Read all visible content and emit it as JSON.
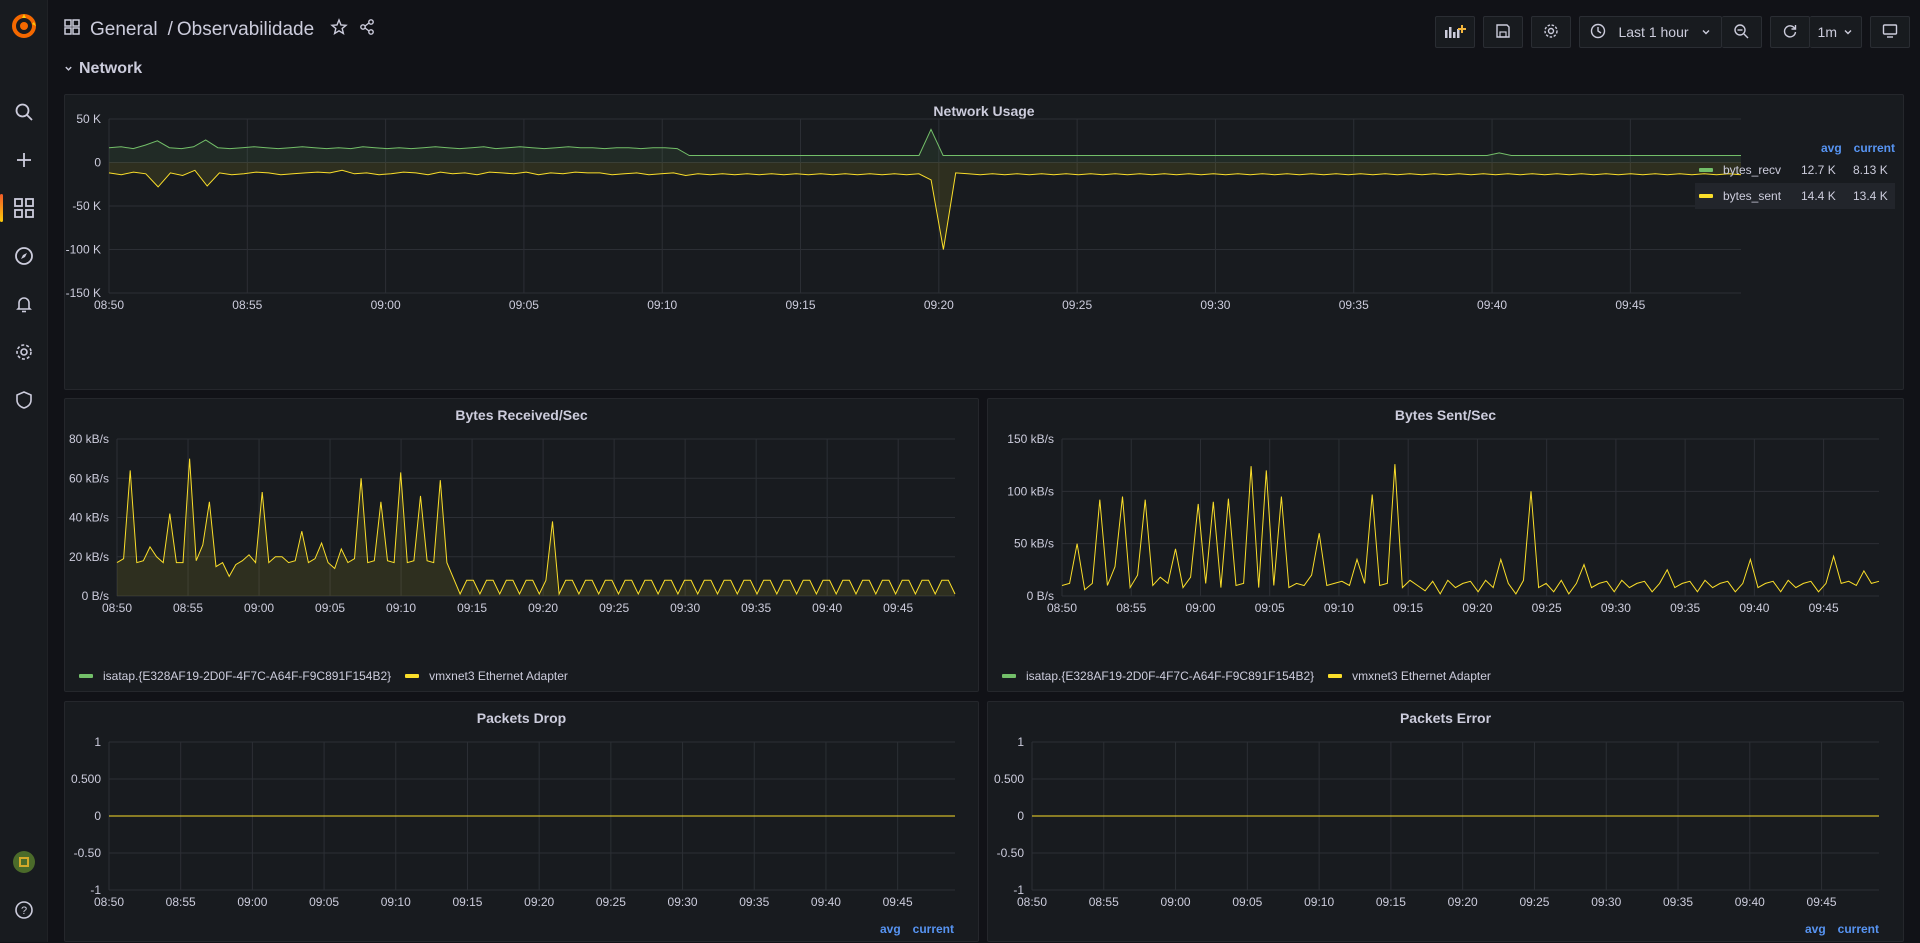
{
  "breadcrumb": {
    "folder": "General",
    "separator": "/",
    "dashboard": "Observabilidade"
  },
  "toolbar": {
    "time_range": "Last 1 hour",
    "refresh_interval": "1m"
  },
  "row": {
    "title": "Network"
  },
  "colors": {
    "recv": "#73bf69",
    "sent": "#fade2a",
    "accent": "#5794f2",
    "bg": "#111217",
    "panel": "#181b1f"
  },
  "icons": [
    "grafana-logo-icon",
    "search-icon",
    "plus-icon",
    "dashboards-icon",
    "explore-icon",
    "alert-bell-icon",
    "gear-icon",
    "shield-icon",
    "user-avatar-icon",
    "help-icon",
    "apps-grid-icon",
    "star-icon",
    "share-icon",
    "add-panel-icon",
    "save-icon",
    "settings-icon",
    "clock-icon",
    "chevron-down-icon",
    "zoom-out-icon",
    "refresh-icon",
    "tv-mode-icon"
  ],
  "network_usage": {
    "title": "Network Usage",
    "legend": {
      "col_avg": "avg",
      "col_current": "current",
      "rows": [
        {
          "name": "bytes_recv",
          "avg": "12.7 K",
          "current": "8.13 K"
        },
        {
          "name": "bytes_sent",
          "avg": "14.4 K",
          "current": "13.4 K"
        }
      ]
    }
  },
  "bytes_received": {
    "title": "Bytes Received/Sec",
    "legend": [
      "isatap.{E328AF19-2D0F-4F7C-A64F-F9C891F154B2}",
      "vmxnet3 Ethernet Adapter"
    ]
  },
  "bytes_sent": {
    "title": "Bytes Sent/Sec",
    "legend": [
      "isatap.{E328AF19-2D0F-4F7C-A64F-F9C891F154B2}",
      "vmxnet3 Ethernet Adapter"
    ]
  },
  "packets_drop": {
    "title": "Packets Drop",
    "col_avg": "avg",
    "col_current": "current"
  },
  "packets_error": {
    "title": "Packets Error",
    "col_avg": "avg",
    "col_current": "current"
  },
  "chart_data": [
    {
      "type": "line",
      "title": "Network Usage",
      "x_ticks": [
        "08:50",
        "08:55",
        "09:00",
        "09:05",
        "09:10",
        "09:15",
        "09:20",
        "09:25",
        "09:30",
        "09:35",
        "09:40",
        "09:45"
      ],
      "y_ticks": [
        "50 K",
        "0",
        "-50 K",
        "-100 K",
        "-150 K"
      ],
      "ylim": [
        -150000,
        50000
      ],
      "series": [
        {
          "name": "bytes_recv",
          "color": "#73bf69",
          "values": [
            17000,
            18000,
            16000,
            20000,
            25000,
            17000,
            16000,
            18000,
            26000,
            17000,
            16000,
            17000,
            18000,
            17000,
            16000,
            17000,
            18000,
            17000,
            16000,
            17000,
            16000,
            18000,
            17000,
            16000,
            17000,
            16000,
            17000,
            18000,
            17000,
            16000,
            17000,
            18000,
            16000,
            17000,
            18000,
            17000,
            16000,
            17000,
            18000,
            17000,
            17000,
            16000,
            17000,
            17000,
            16000,
            17000,
            17000,
            16000,
            8000,
            8000,
            8000,
            8000,
            8000,
            8000,
            8000,
            8000,
            8000,
            8000,
            8000,
            8000,
            8000,
            8000,
            8000,
            8000,
            8000,
            8000,
            8000,
            8000,
            38000,
            8000,
            8000,
            8000,
            8000,
            8000,
            8000,
            8000,
            8000,
            8000,
            8000,
            8000,
            8000,
            8000,
            8000,
            8000,
            8000,
            8000,
            8000,
            8000,
            8000,
            8000,
            8000,
            8000,
            8000,
            8000,
            8000,
            8000,
            8000,
            8000,
            8000,
            8000,
            8000,
            8000,
            8000,
            8000,
            8000,
            8000,
            8000,
            8000,
            8000,
            8000,
            8000,
            8000,
            8000,
            8000,
            8000,
            11000,
            8000,
            8000,
            8000,
            8000,
            8000,
            8000,
            8000,
            8000,
            8000,
            8000,
            8000,
            8000,
            8000,
            8000,
            8000,
            8000,
            8000,
            8000,
            8000,
            8000
          ]
        },
        {
          "name": "bytes_sent",
          "color": "#fade2a",
          "values": [
            -12000,
            -14000,
            -11000,
            -13000,
            -28000,
            -12000,
            -15000,
            -9000,
            -27000,
            -12000,
            -14000,
            -13000,
            -11000,
            -12000,
            -14000,
            -13000,
            -12000,
            -11000,
            -12000,
            -9000,
            -13000,
            -12000,
            -14000,
            -13000,
            -11000,
            -12000,
            -14000,
            -11000,
            -13000,
            -12000,
            -14000,
            -11000,
            -12000,
            -13000,
            -11000,
            -14000,
            -12000,
            -13000,
            -11000,
            -12000,
            -12000,
            -14000,
            -13000,
            -12000,
            -14000,
            -13000,
            -12000,
            -15000,
            -13000,
            -14000,
            -13000,
            -14000,
            -13000,
            -14000,
            -13000,
            -14000,
            -13000,
            -14000,
            -13000,
            -14000,
            -13000,
            -14000,
            -13000,
            -14000,
            -13000,
            -14000,
            -13000,
            -20000,
            -100000,
            -12000,
            -13000,
            -14000,
            -13000,
            -14000,
            -13000,
            -14000,
            -13000,
            -14000,
            -13000,
            -14000,
            -13000,
            -14000,
            -13000,
            -14000,
            -13000,
            -14000,
            -13000,
            -14000,
            -13000,
            -14000,
            -13000,
            -14000,
            -13000,
            -14000,
            -13000,
            -14000,
            -13000,
            -14000,
            -13000,
            -14000,
            -13000,
            -14000,
            -13000,
            -14000,
            -13000,
            -14000,
            -13000,
            -14000,
            -13000,
            -14000,
            -13000,
            -14000,
            -13000,
            -14000,
            -13000,
            -14000,
            -13000,
            -14000,
            -13000,
            -14000,
            -13000,
            -14000,
            -13000,
            -14000,
            -13000,
            -14000,
            -13000,
            -14000,
            -13000,
            -14000,
            -13000,
            -14000,
            -13000,
            -14000
          ]
        }
      ]
    },
    {
      "type": "area",
      "title": "Bytes Received/Sec",
      "x_ticks": [
        "08:50",
        "08:55",
        "09:00",
        "09:05",
        "09:10",
        "09:15",
        "09:20",
        "09:25",
        "09:30",
        "09:35",
        "09:40",
        "09:45"
      ],
      "y_ticks": [
        "80 kB/s",
        "60 kB/s",
        "40 kB/s",
        "20 kB/s",
        "0 B/s"
      ],
      "ylim": [
        0,
        80
      ],
      "series": [
        {
          "name": "isatap.{E328AF19-2D0F-4F7C-A64F-F9C891F154B2}",
          "color": "#73bf69",
          "values": []
        },
        {
          "name": "vmxnet3 Ethernet Adapter",
          "color": "#fade2a",
          "values": [
            17,
            19,
            64,
            17,
            18,
            25,
            20,
            17,
            42,
            17,
            17,
            70,
            18,
            26,
            48,
            15,
            17,
            10,
            16,
            18,
            21,
            17,
            53,
            17,
            20,
            20,
            17,
            18,
            33,
            17,
            19,
            27,
            17,
            14,
            24,
            17,
            19,
            60,
            17,
            18,
            48,
            18,
            17,
            63,
            17,
            18,
            51,
            18,
            17,
            59,
            17,
            9,
            1,
            8,
            8,
            1,
            8,
            8,
            1,
            8,
            8,
            1,
            8,
            8,
            1,
            8,
            38,
            1,
            8,
            8,
            1,
            8,
            8,
            1,
            8,
            8,
            1,
            8,
            8,
            1,
            8,
            8,
            1,
            8,
            8,
            1,
            8,
            8,
            1,
            8,
            8,
            1,
            8,
            8,
            1,
            8,
            8,
            1,
            8,
            8,
            1,
            8,
            8,
            1,
            8,
            8,
            1,
            8,
            8,
            1,
            8,
            8,
            1,
            8,
            8,
            1,
            8,
            8,
            1,
            8,
            8,
            1,
            8,
            8,
            1,
            8,
            8,
            1
          ]
        }
      ]
    },
    {
      "type": "line",
      "title": "Bytes Sent/Sec",
      "x_ticks": [
        "08:50",
        "08:55",
        "09:00",
        "09:05",
        "09:10",
        "09:15",
        "09:20",
        "09:25",
        "09:30",
        "09:35",
        "09:40",
        "09:45"
      ],
      "y_ticks": [
        "150 kB/s",
        "100 kB/s",
        "50 kB/s",
        "0 B/s"
      ],
      "ylim": [
        0,
        150
      ],
      "series": [
        {
          "name": "isatap.{E328AF19-2D0F-4F7C-A64F-F9C891F154B2}",
          "color": "#73bf69",
          "values": []
        },
        {
          "name": "vmxnet3 Ethernet Adapter",
          "color": "#fade2a",
          "values": [
            10,
            12,
            50,
            6,
            12,
            92,
            10,
            28,
            95,
            8,
            20,
            92,
            10,
            18,
            12,
            45,
            8,
            18,
            88,
            12,
            90,
            8,
            93,
            10,
            12,
            124,
            8,
            120,
            10,
            95,
            8,
            12,
            10,
            20,
            60,
            10,
            12,
            14,
            10,
            35,
            12,
            97,
            10,
            12,
            126,
            8,
            15,
            10,
            5,
            14,
            2,
            15,
            8,
            12,
            14,
            4,
            15,
            8,
            35,
            12,
            2,
            15,
            100,
            8,
            12,
            4,
            15,
            2,
            12,
            30,
            8,
            12,
            14,
            4,
            15,
            8,
            12,
            14,
            4,
            12,
            25,
            8,
            12,
            14,
            4,
            15,
            8,
            12,
            14,
            4,
            12,
            35,
            8,
            12,
            14,
            4,
            15,
            8,
            12,
            14,
            4,
            12,
            38,
            12,
            14,
            10,
            24,
            12,
            14
          ]
        }
      ]
    },
    {
      "type": "line",
      "title": "Packets Drop",
      "x_ticks": [
        "08:50",
        "08:55",
        "09:00",
        "09:05",
        "09:10",
        "09:15",
        "09:20",
        "09:25",
        "09:30",
        "09:35",
        "09:40",
        "09:45"
      ],
      "y_ticks": [
        "1",
        "0.500",
        "0",
        "-0.50",
        "-1"
      ],
      "ylim": [
        -1,
        1
      ],
      "series": [
        {
          "name": "",
          "color": "#fade2a",
          "values": [
            0,
            0
          ]
        }
      ]
    },
    {
      "type": "line",
      "title": "Packets Error",
      "x_ticks": [
        "08:50",
        "08:55",
        "09:00",
        "09:05",
        "09:10",
        "09:15",
        "09:20",
        "09:25",
        "09:30",
        "09:35",
        "09:40",
        "09:45"
      ],
      "y_ticks": [
        "1",
        "0.500",
        "0",
        "-0.50",
        "-1"
      ],
      "ylim": [
        -1,
        1
      ],
      "series": [
        {
          "name": "",
          "color": "#fade2a",
          "values": [
            0,
            0
          ]
        }
      ]
    }
  ]
}
